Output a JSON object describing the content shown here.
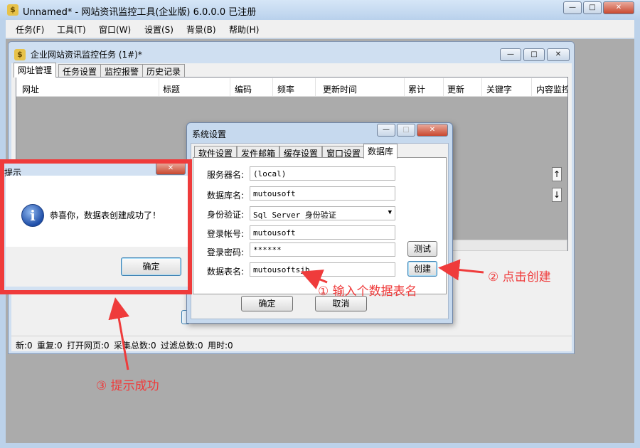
{
  "app": {
    "title": "Unnamed* - 网站资讯监控工具(企业版) 6.0.0.0 已注册",
    "icon_glyph": "$",
    "caption": {
      "minimize": "—",
      "maximize": "□",
      "close": "✕"
    }
  },
  "menu": [
    "任务(F)",
    "工具(T)",
    "窗口(W)",
    "设置(S)",
    "背景(B)",
    "帮助(H)"
  ],
  "task_window": {
    "title": "企业网站资讯监控任务 (1#)*",
    "tabs": [
      "网址管理",
      "任务设置",
      "监控报警",
      "历史记录"
    ],
    "columns": [
      "网址",
      "标题",
      "编码",
      "频率",
      "更新时间",
      "累计",
      "更新",
      "关键字",
      "内容监控"
    ],
    "scroll_up": "↑",
    "scroll_down": "↓",
    "status": [
      "新:0",
      "重复:0",
      "打开网页:0",
      "采集总数:0",
      "过滤总数:0",
      "用时:0"
    ]
  },
  "settings_dialog": {
    "title": "系统设置",
    "tabs": [
      "软件设置",
      "发件邮箱",
      "缓存设置",
      "窗口设置",
      "数据库"
    ],
    "fields": {
      "server_label": "服务器名:",
      "server_value": "(local)",
      "database_label": "数据库名:",
      "database_value": "mutousoft",
      "auth_label": "身份验证:",
      "auth_value": "Sql Server 身份验证",
      "login_label": "登录帐号:",
      "login_value": "mutousoft",
      "password_label": "登录密码:",
      "password_value": "******",
      "table_label": "数据表名:",
      "table_value": "mutousoftsjb"
    },
    "test_button": "测试",
    "create_button": "创建",
    "ok_button": "确定",
    "cancel_button": "取消"
  },
  "message_box": {
    "title": "提示",
    "message": "恭喜你，数据表创建成功了！",
    "ok_button": "确定"
  },
  "annotations": {
    "step1": "① 输入个数据表名",
    "step2": "② 点击创建",
    "step3": "③ 提示成功",
    "color": "#ef3b3b"
  }
}
